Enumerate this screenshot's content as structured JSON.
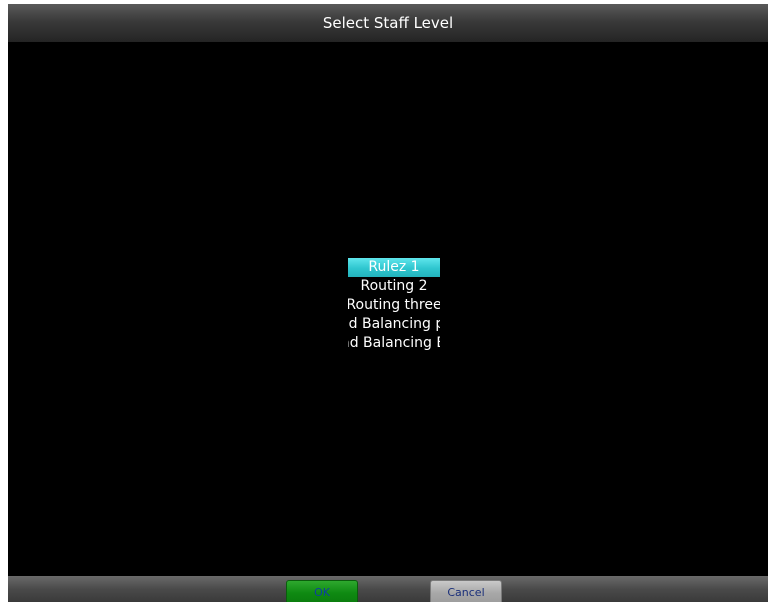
{
  "dialog": {
    "title": "Select Staff Level"
  },
  "staff_levels": {
    "selected_index": 0,
    "items": [
      {
        "label": "Rulez 1"
      },
      {
        "label": "Routing 2"
      },
      {
        "label": "Routing three"
      },
      {
        "label": "Load Balancing part"
      },
      {
        "label": "Load Balancing End"
      }
    ]
  },
  "footer": {
    "ok_label": "OK",
    "cancel_label": "Cancel"
  },
  "colors": {
    "selection": "#2fc6cf",
    "ok_button": "#0f8a12",
    "cancel_button": "#a8a8a8"
  }
}
